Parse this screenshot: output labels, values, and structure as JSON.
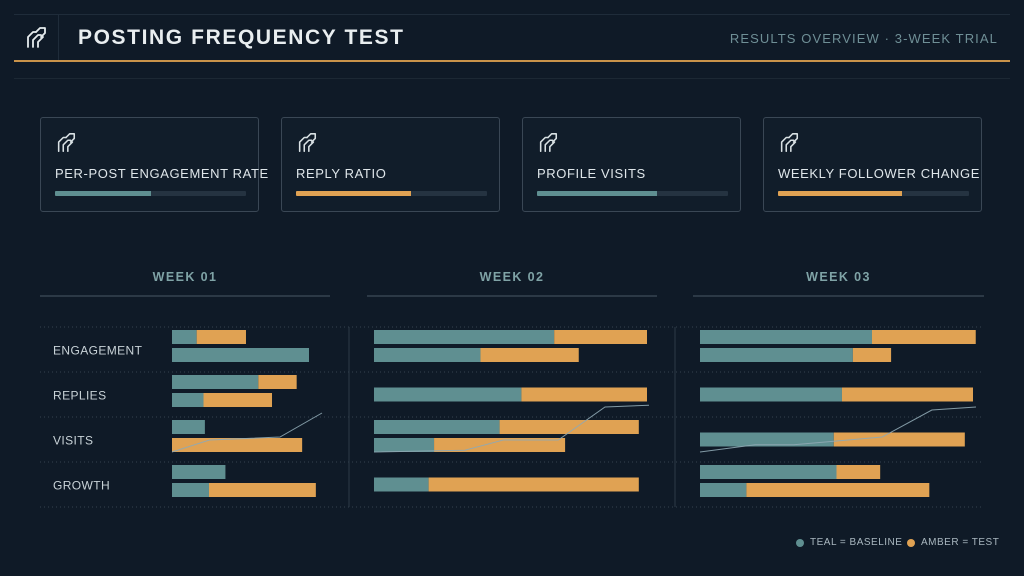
{
  "header": {
    "title": "POSTING FREQUENCY TEST",
    "subtitle": "RESULTS OVERVIEW · 3-WEEK TRIAL",
    "logo_icon": "brand-logo-icon"
  },
  "colors": {
    "background": "#0f1a27",
    "teal": "#5f8f91",
    "amber": "#e0a253",
    "accent": "#c9934a"
  },
  "cards": [
    {
      "label": "PER-POST ENGAGEMENT RATE",
      "icon": "brand-logo-icon",
      "progress": 0.5,
      "color": "#5f8f91"
    },
    {
      "label": "REPLY RATIO",
      "icon": "brand-logo-icon",
      "progress": 0.6,
      "color": "#e0a253"
    },
    {
      "label": "PROFILE VISITS",
      "icon": "brand-logo-icon",
      "progress": 0.63,
      "color": "#5f8f91"
    },
    {
      "label": "WEEKLY FOLLOWER CHANGE",
      "icon": "brand-logo-icon",
      "progress": 0.65,
      "color": "#e0a253"
    }
  ],
  "legend": {
    "baseline": "TEAL = BASELINE",
    "test": "AMBER = TEST"
  },
  "chart_data": {
    "type": "bar",
    "orientation": "horizontal",
    "categories": [
      "ENGAGEMENT",
      "REPLIES",
      "VISITS",
      "GROWTH"
    ],
    "xlim": [
      0,
      100
    ],
    "weeks": [
      {
        "label": "WEEK 01",
        "rows": [
          [
            {
              "teal": 18,
              "amber": 36
            },
            {
              "teal": 100,
              "amber": 0
            }
          ],
          [
            {
              "teal": 63,
              "amber": 28
            },
            {
              "teal": 23,
              "amber": 50
            }
          ],
          [
            {
              "teal": 24,
              "amber": 0
            },
            {
              "teal": 0,
              "amber": 95
            }
          ],
          [
            {
              "teal": 39,
              "amber": 0
            },
            {
              "teal": 27,
              "amber": 78
            }
          ]
        ],
        "trend": [
          [
            0,
            0
          ],
          [
            25,
            20
          ],
          [
            72,
            25
          ],
          [
            100,
            65
          ]
        ]
      },
      {
        "label": "WEEK 02",
        "rows": [
          [
            {
              "teal": 66,
              "amber": 34
            },
            {
              "teal": 39,
              "amber": 36
            }
          ],
          [
            {
              "teal": 54,
              "amber": 46
            }
          ],
          [
            {
              "teal": 46,
              "amber": 51
            },
            {
              "teal": 22,
              "amber": 48
            }
          ],
          [
            {
              "teal": 20,
              "amber": 77
            }
          ]
        ],
        "trend": [
          [
            0,
            0
          ],
          [
            33,
            3
          ],
          [
            47,
            20
          ],
          [
            67,
            20
          ],
          [
            84,
            75
          ],
          [
            100,
            78
          ]
        ]
      },
      {
        "label": "WEEK 03",
        "rows": [
          [
            {
              "teal": 63,
              "amber": 38
            },
            {
              "teal": 56,
              "amber": 14
            }
          ],
          [
            {
              "teal": 52,
              "amber": 48
            }
          ],
          [
            {
              "teal": 49,
              "amber": 48
            }
          ],
          [
            {
              "teal": 50,
              "amber": 16
            },
            {
              "teal": 17,
              "amber": 67
            }
          ]
        ],
        "trend": [
          [
            0,
            0
          ],
          [
            20,
            12
          ],
          [
            34,
            12
          ],
          [
            66,
            25
          ],
          [
            84,
            70
          ],
          [
            100,
            75
          ]
        ]
      }
    ]
  }
}
